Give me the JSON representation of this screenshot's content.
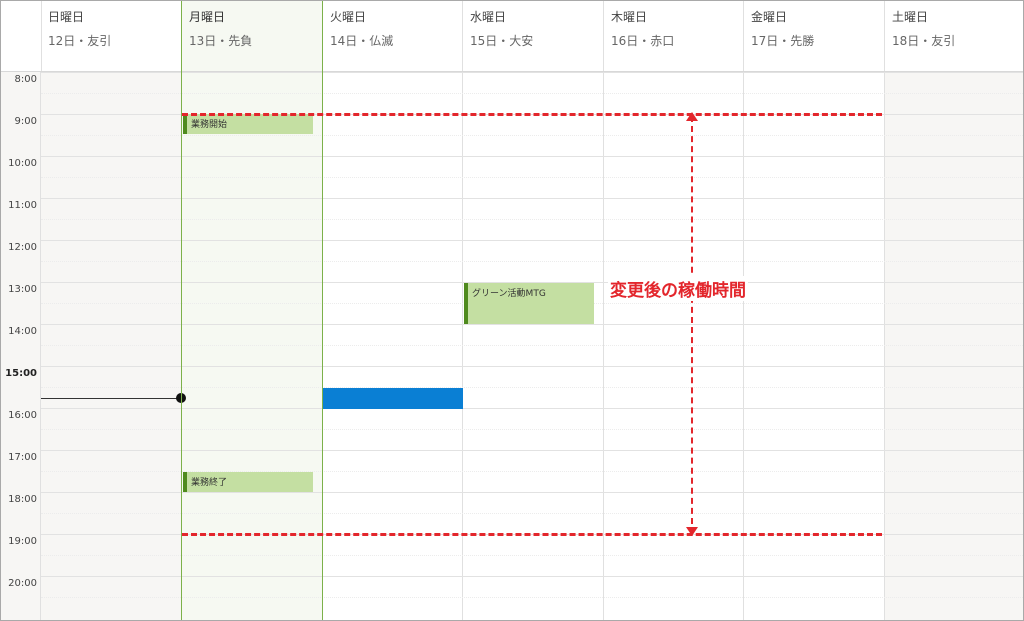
{
  "days": [
    {
      "name": "日曜日",
      "date": "12日・友引"
    },
    {
      "name": "月曜日",
      "date": "13日・先負"
    },
    {
      "name": "火曜日",
      "date": "14日・仏滅"
    },
    {
      "name": "水曜日",
      "date": "15日・大安"
    },
    {
      "name": "木曜日",
      "date": "16日・赤口"
    },
    {
      "name": "金曜日",
      "date": "17日・先勝"
    },
    {
      "name": "土曜日",
      "date": "18日・友引"
    }
  ],
  "times": [
    "8:00",
    "9:00",
    "10:00",
    "11:00",
    "12:00",
    "13:00",
    "14:00",
    "15:00",
    "16:00",
    "17:00",
    "18:00",
    "19:00",
    "20:00"
  ],
  "current_hour_label": "15:00",
  "events": [
    {
      "title": "業務開始",
      "day": "月曜日"
    },
    {
      "title": "グリーン活動MTG",
      "day": "水曜日"
    },
    {
      "title": "業務終了",
      "day": "月曜日"
    },
    {
      "title": "",
      "day": "火曜日"
    }
  ],
  "annotation": {
    "label": "変更後の稼働時間",
    "color": "#e3262c"
  },
  "colors": {
    "event_green": "#c4dfa2",
    "event_green_bar": "#4f8a1e",
    "event_blue": "#0a7fd4",
    "today_outline": "#7cb14a"
  }
}
